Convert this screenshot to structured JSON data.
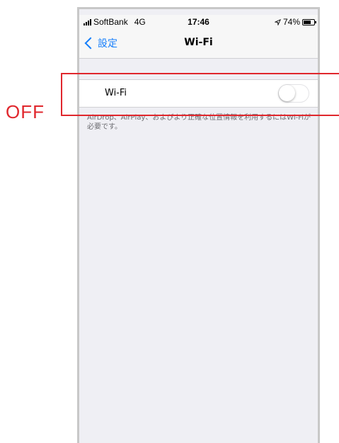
{
  "status_bar": {
    "carrier": "SoftBank",
    "network": "4G",
    "time": "17:46",
    "battery_percent": "74%",
    "battery_level": 0.74,
    "location_icon": "location-arrow-icon"
  },
  "nav": {
    "back_label": "設定",
    "title": "Wi-Fi"
  },
  "wifi": {
    "label": "Wi-Fi",
    "enabled": false
  },
  "footnote": "AirDrop、AirPlay、およびより正確な位置情報を利用するにはWi-Fiが必要です。",
  "annotation": {
    "label": "OFF",
    "color": "#e0272d"
  },
  "colors": {
    "accent": "#157efb",
    "background": "#efeff4"
  }
}
